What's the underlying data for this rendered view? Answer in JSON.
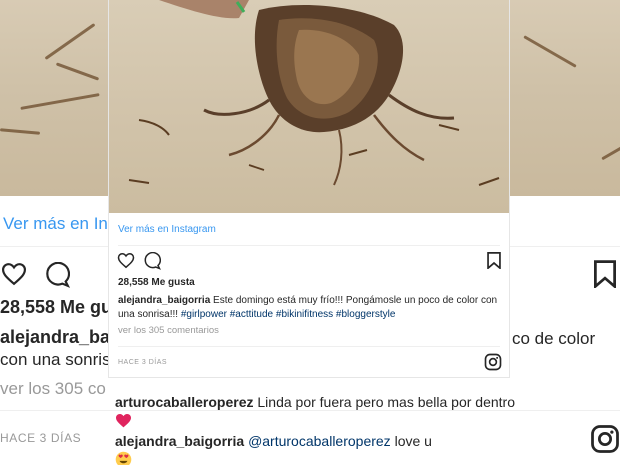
{
  "background": {
    "view_more": "Ver más en In",
    "likes": "28,558 Me gus",
    "username": "alejandra_baig",
    "caption_continuation": "con una sonris",
    "caption_tail": "co de color",
    "view_comments": "ver los 305 co",
    "timestamp": "HACE 3 DÍAS"
  },
  "post": {
    "view_more_link": "Ver más en Instagram",
    "likes": "28,558 Me gusta",
    "username": "alejandra_baigorria",
    "caption": "Este domingo está muy frío!!! Pongámosle un poco de color con una sonrisa!!!",
    "hashtags": "#girlpower #acttitude #bikinifitness #bloggerstyle",
    "view_comments": "ver los 305 comentarios",
    "timestamp": "HACE 3 DÍAS"
  },
  "comments": [
    {
      "user": "arturocaballeroperez",
      "text": "Linda por fuera pero mas bella por dentro",
      "emoji": "red-heart"
    },
    {
      "user": "alejandra_baigorria",
      "mention": "@arturocaballeroperez",
      "text": "love u",
      "emoji": "heart-eyes-face"
    }
  ],
  "colors": {
    "link": "#3897f0",
    "hashtag": "#003569",
    "muted": "#999999",
    "text": "#262626",
    "heart": "#ed4956"
  },
  "icons": [
    "heart-icon",
    "comment-icon",
    "bookmark-icon",
    "instagram-icon"
  ]
}
